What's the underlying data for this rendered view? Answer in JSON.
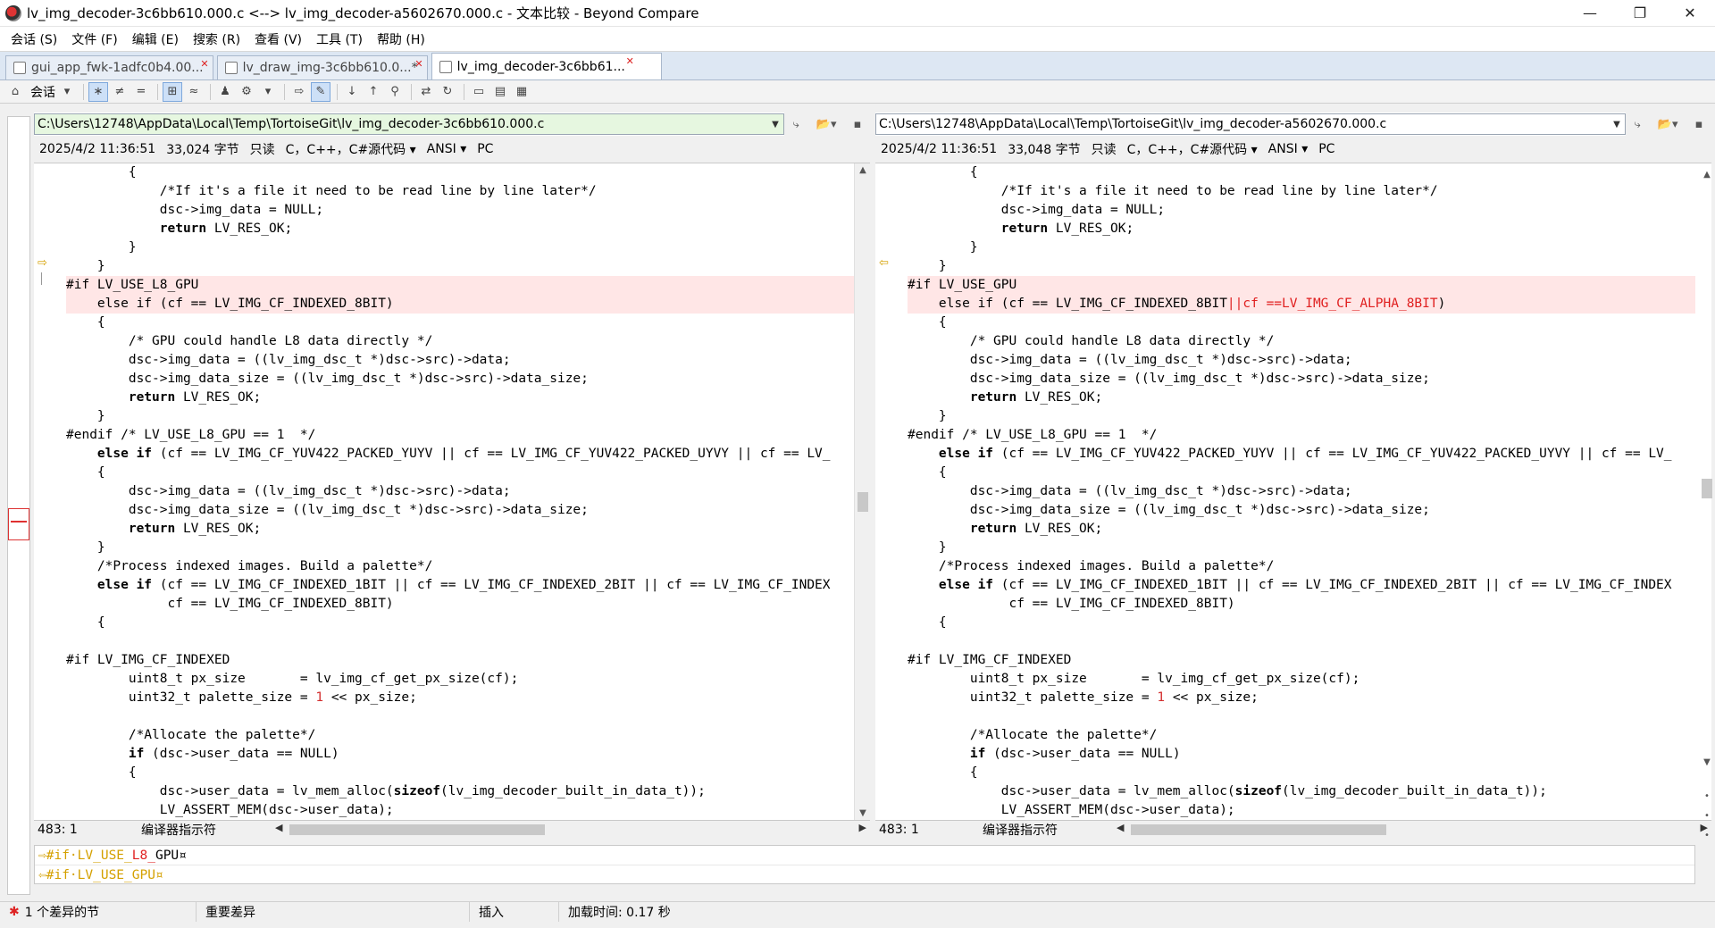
{
  "window": {
    "title": "lv_img_decoder-3c6bb610.000.c <--> lv_img_decoder-a5602670.000.c - 文本比较 - Beyond Compare",
    "minimize": "—",
    "maximize": "❐",
    "close": "✕"
  },
  "menu": [
    "会话 (S)",
    "文件 (F)",
    "编辑 (E)",
    "搜索 (R)",
    "查看 (V)",
    "工具 (T)",
    "帮助 (H)"
  ],
  "tabs": [
    {
      "label": "gui_app_fwk-1adfc0b4.00..."
    },
    {
      "label": "lv_draw_img-3c6bb610.0...*"
    },
    {
      "label": "lv_img_decoder-3c6bb61..."
    }
  ],
  "toolbar": {
    "session_label": "会话"
  },
  "left": {
    "path": "C:\\Users\\12748\\AppData\\Local\\Temp\\TortoiseGit\\lv_img_decoder-3c6bb610.000.c",
    "date": "2025/4/2 11:36:51",
    "size": "33,024 字节",
    "readonly": "只读",
    "lang": "C，C++，C#源代码",
    "encoding": "ANSI",
    "lineend": "PC",
    "pos": "483: 1",
    "kind": "编译器指示符"
  },
  "right": {
    "path": "C:\\Users\\12748\\AppData\\Local\\Temp\\TortoiseGit\\lv_img_decoder-a5602670.000.c",
    "date": "2025/4/2 11:36:51",
    "size": "33,048 字节",
    "readonly": "只读",
    "lang": "C，C++，C#源代码",
    "encoding": "ANSI",
    "lineend": "PC",
    "pos": "483: 1",
    "kind": "编译器指示符"
  },
  "code": {
    "l1": "        {",
    "l2": "            /*If it's a file it need to be read line by line later*/",
    "l3": "            dsc->img_data = NULL;",
    "l4": "            return",
    "l4b": " LV_RES_OK;",
    "l5": "        }",
    "l6": "    }",
    "left_if": "#if LV_USE_L8_GPU",
    "right_if": "#if LV_USE_GPU",
    "left_else": "    else if (cf == LV_IMG_CF_INDEXED_8BIT)",
    "right_else_a": "    else if (cf == LV_IMG_CF_INDEXED_8BIT",
    "right_else_b": "||cf ==LV_IMG_CF_ALPHA_8BIT",
    "right_else_c": ")",
    "l9": "    {",
    "l10": "        /* GPU could handle L8 data directly */",
    "l11": "        dsc->img_data = ((lv_img_dsc_t *)dsc->src)->data;",
    "l12": "        dsc->img_data_size = ((lv_img_dsc_t *)dsc->src)->data_size;",
    "l13a": "        return",
    "l13b": " LV_RES_OK;",
    "l14": "    }",
    "l15": "#endif /* LV_USE_L8_GPU == 1  */",
    "l16a": "    else if",
    "l16b": " (cf == LV_IMG_CF_YUV422_PACKED_YUYV || cf == LV_IMG_CF_YUV422_PACKED_UYVY || cf == LV_",
    "l17": "    {",
    "l18": "        dsc->img_data = ((lv_img_dsc_t *)dsc->src)->data;",
    "l19": "        dsc->img_data_size = ((lv_img_dsc_t *)dsc->src)->data_size;",
    "l20a": "        return",
    "l20b": " LV_RES_OK;",
    "l21": "    }",
    "l22": "    /*Process indexed images. Build a palette*/",
    "l23a": "    else if",
    "l23b": " (cf == LV_IMG_CF_INDEXED_1BIT || cf == LV_IMG_CF_INDEXED_2BIT || cf == LV_IMG_CF_INDEX",
    "l24": "             cf == LV_IMG_CF_INDEXED_8BIT)",
    "l25": "    {",
    "l26": "",
    "l27": "#if LV_IMG_CF_INDEXED",
    "l28": "        uint8_t px_size       = lv_img_cf_get_px_size(cf);",
    "l29a": "        uint32_t palette_size = ",
    "l29b": "1",
    "l29c": " << px_size;",
    "l30": "",
    "l31": "        /*Allocate the palette*/",
    "l32a": "        if",
    "l32b": " (dsc->user_data == NULL)",
    "l33": "        {",
    "l34a": "            dsc->user_data = lv_mem_alloc(",
    "l34b": "sizeof",
    "l34c": "(lv_img_decoder_built_in_data_t));",
    "l35": "            LV_ASSERT_MEM(dsc->user_data);"
  },
  "detail": {
    "left_a": "⇨#if·LV_USE_",
    "left_b": "L8_",
    "left_c": "GPU¤",
    "right_a": "⇦#if·LV_USE_GPU¤"
  },
  "status": {
    "diffs": "1 个差异的节",
    "importance": "重要差异",
    "mode": "插入",
    "loadtime": "加载时间:  0.17 秒"
  }
}
